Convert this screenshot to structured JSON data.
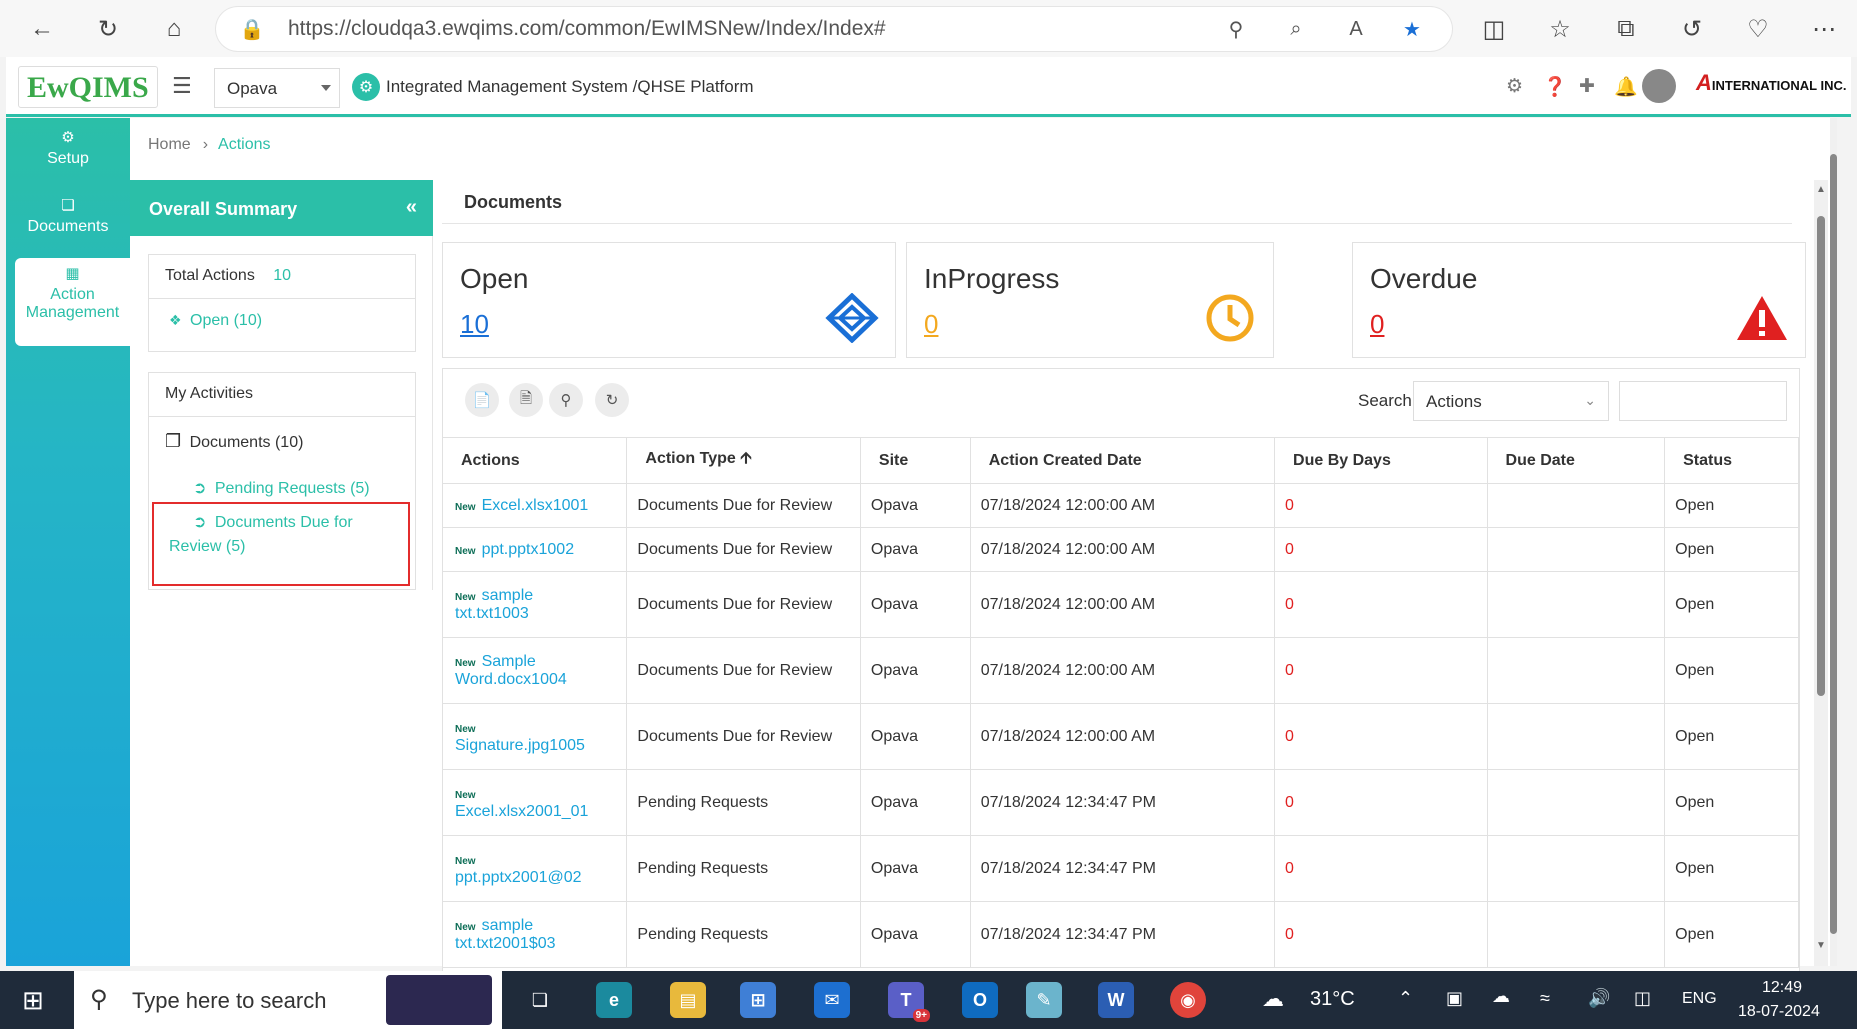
{
  "browser": {
    "url": "https://cloudqa3.ewqims.com/common/EwIMSNew/Index/Index#"
  },
  "header": {
    "logo_text": "EwQIMS",
    "site": "Opava",
    "platform_title": "Integrated Management System /QHSE Platform",
    "company": "INTERNATIONAL INC."
  },
  "nav": {
    "setup": "Setup",
    "documents": "Documents",
    "action_management": "Action Management"
  },
  "breadcrumb": {
    "home": "Home",
    "current": "Actions"
  },
  "summary": {
    "title": "Overall Summary",
    "total_actions_label": "Total Actions",
    "total_actions_value": "10",
    "open_link": "Open (10)",
    "my_activities": "My Activities",
    "documents_label": "Documents (10)",
    "pending_requests": "Pending Requests (5)",
    "docs_due_review": "Documents Due for Review (5)"
  },
  "docs": {
    "title": "Documents",
    "stats": [
      {
        "label": "Open",
        "value": "10",
        "color": "#1a6fd6"
      },
      {
        "label": "InProgress",
        "value": "0",
        "color": "#f3a81f"
      },
      {
        "label": "Overdue",
        "value": "0",
        "color": "#e02020"
      }
    ]
  },
  "toolbar": {
    "search_label": "Search",
    "search_select": "Actions"
  },
  "table": {
    "columns": [
      "Actions",
      "Action Type",
      "Site",
      "Action Created Date",
      "Due By Days",
      "Due Date",
      "Status"
    ],
    "new_badge": "New",
    "rows": [
      {
        "name": "Excel.xlsx1001",
        "type": "Documents Due for Review",
        "site": "Opava",
        "created": "07/18/2024 12:00:00 AM",
        "due_days": "0",
        "due_date": "",
        "status": "Open"
      },
      {
        "name": "ppt.pptx1002",
        "type": "Documents Due for Review",
        "site": "Opava",
        "created": "07/18/2024 12:00:00 AM",
        "due_days": "0",
        "due_date": "",
        "status": "Open"
      },
      {
        "name1": "sample",
        "name2": "txt.txt1003",
        "type": "Documents Due for Review",
        "site": "Opava",
        "created": "07/18/2024 12:00:00 AM",
        "due_days": "0",
        "due_date": "",
        "status": "Open"
      },
      {
        "name1": "Sample",
        "name2": "Word.docx1004",
        "type": "Documents Due for Review",
        "site": "Opava",
        "created": "07/18/2024 12:00:00 AM",
        "due_days": "0",
        "due_date": "",
        "status": "Open"
      },
      {
        "name1": "",
        "name2": "Signature.jpg1005",
        "type": "Documents Due for Review",
        "site": "Opava",
        "created": "07/18/2024 12:00:00 AM",
        "due_days": "0",
        "due_date": "",
        "status": "Open"
      },
      {
        "name1": "",
        "name2": "Excel.xlsx2001_01",
        "type": "Pending Requests",
        "site": "Opava",
        "created": "07/18/2024 12:34:47 PM",
        "due_days": "0",
        "due_date": "",
        "status": "Open"
      },
      {
        "name1": "",
        "name2": "ppt.pptx2001@02",
        "type": "Pending Requests",
        "site": "Opava",
        "created": "07/18/2024 12:34:47 PM",
        "due_days": "0",
        "due_date": "",
        "status": "Open"
      },
      {
        "name1": "sample",
        "name2": "txt.txt2001$03",
        "type": "Pending Requests",
        "site": "Opava",
        "created": "07/18/2024 12:34:47 PM",
        "due_days": "0",
        "due_date": "",
        "status": "Open"
      }
    ]
  },
  "taskbar": {
    "search_placeholder": "Type here to search",
    "weather": "31°C",
    "language": "ENG",
    "time": "12:49",
    "date": "18-07-2024",
    "teams_badge": "9+"
  }
}
